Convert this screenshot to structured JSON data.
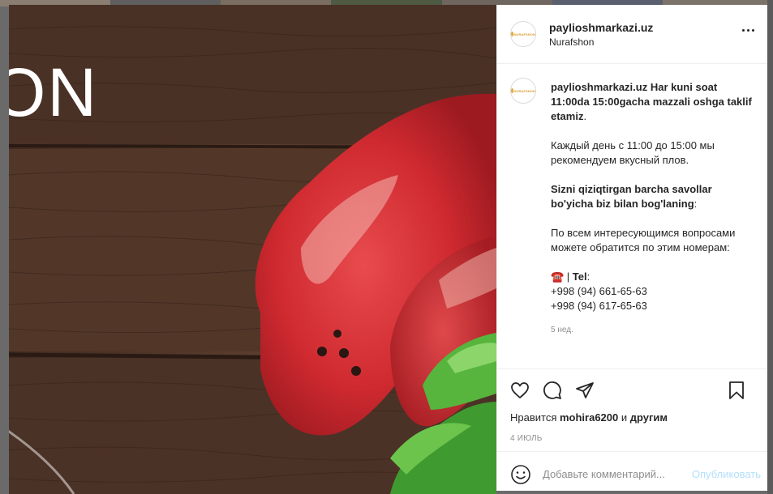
{
  "post": {
    "brand_fragment": "ON",
    "header": {
      "username": "paylioshmarkazi.uz",
      "location": "Nurafshon",
      "avatar_text": "NURAFSHON"
    },
    "caption": {
      "username": "paylioshmarkazi.uz",
      "line1_bold": "Har kuni soat 11:00da 15:00gacha mazzali oshga taklif etamiz",
      "line1_end": ".",
      "line2": "Каждый день с 11:00 до 15:00 мы рекомендуем вкусный плов.",
      "line3_bold": "Sizni qiziqtirgan barcha savollar bo'yicha biz bilan bog'laning",
      "line3_end": ":",
      "line4": "По всем интересующимся вопросами можете обратится по этим номерам:",
      "phone_icon": "☎️",
      "tel_sep": " | ",
      "tel_label": "Tel",
      "tel_colon": ":",
      "phone1": "+998 (94) 661-65-63",
      "phone2": "+998 (94) 617-65-63",
      "age": "5 нед."
    },
    "likes": {
      "prefix": "Нравится ",
      "user": "mohira6200",
      "middle": " и ",
      "others": "другим"
    },
    "date": "4 ИЮЛЬ",
    "comment": {
      "placeholder": "Добавьте комментарий...",
      "publish_label": "Опубликовать"
    }
  },
  "colors": {
    "accent_disabled": "#b2dffc",
    "text_primary": "#262626",
    "text_secondary": "#8e8e8e",
    "wood": "#4b3226",
    "meat": "#c8262b"
  },
  "icons": [
    "more-options-icon",
    "heart-icon",
    "comment-icon",
    "share-icon",
    "bookmark-icon",
    "emoji-icon",
    "phone-icon"
  ]
}
